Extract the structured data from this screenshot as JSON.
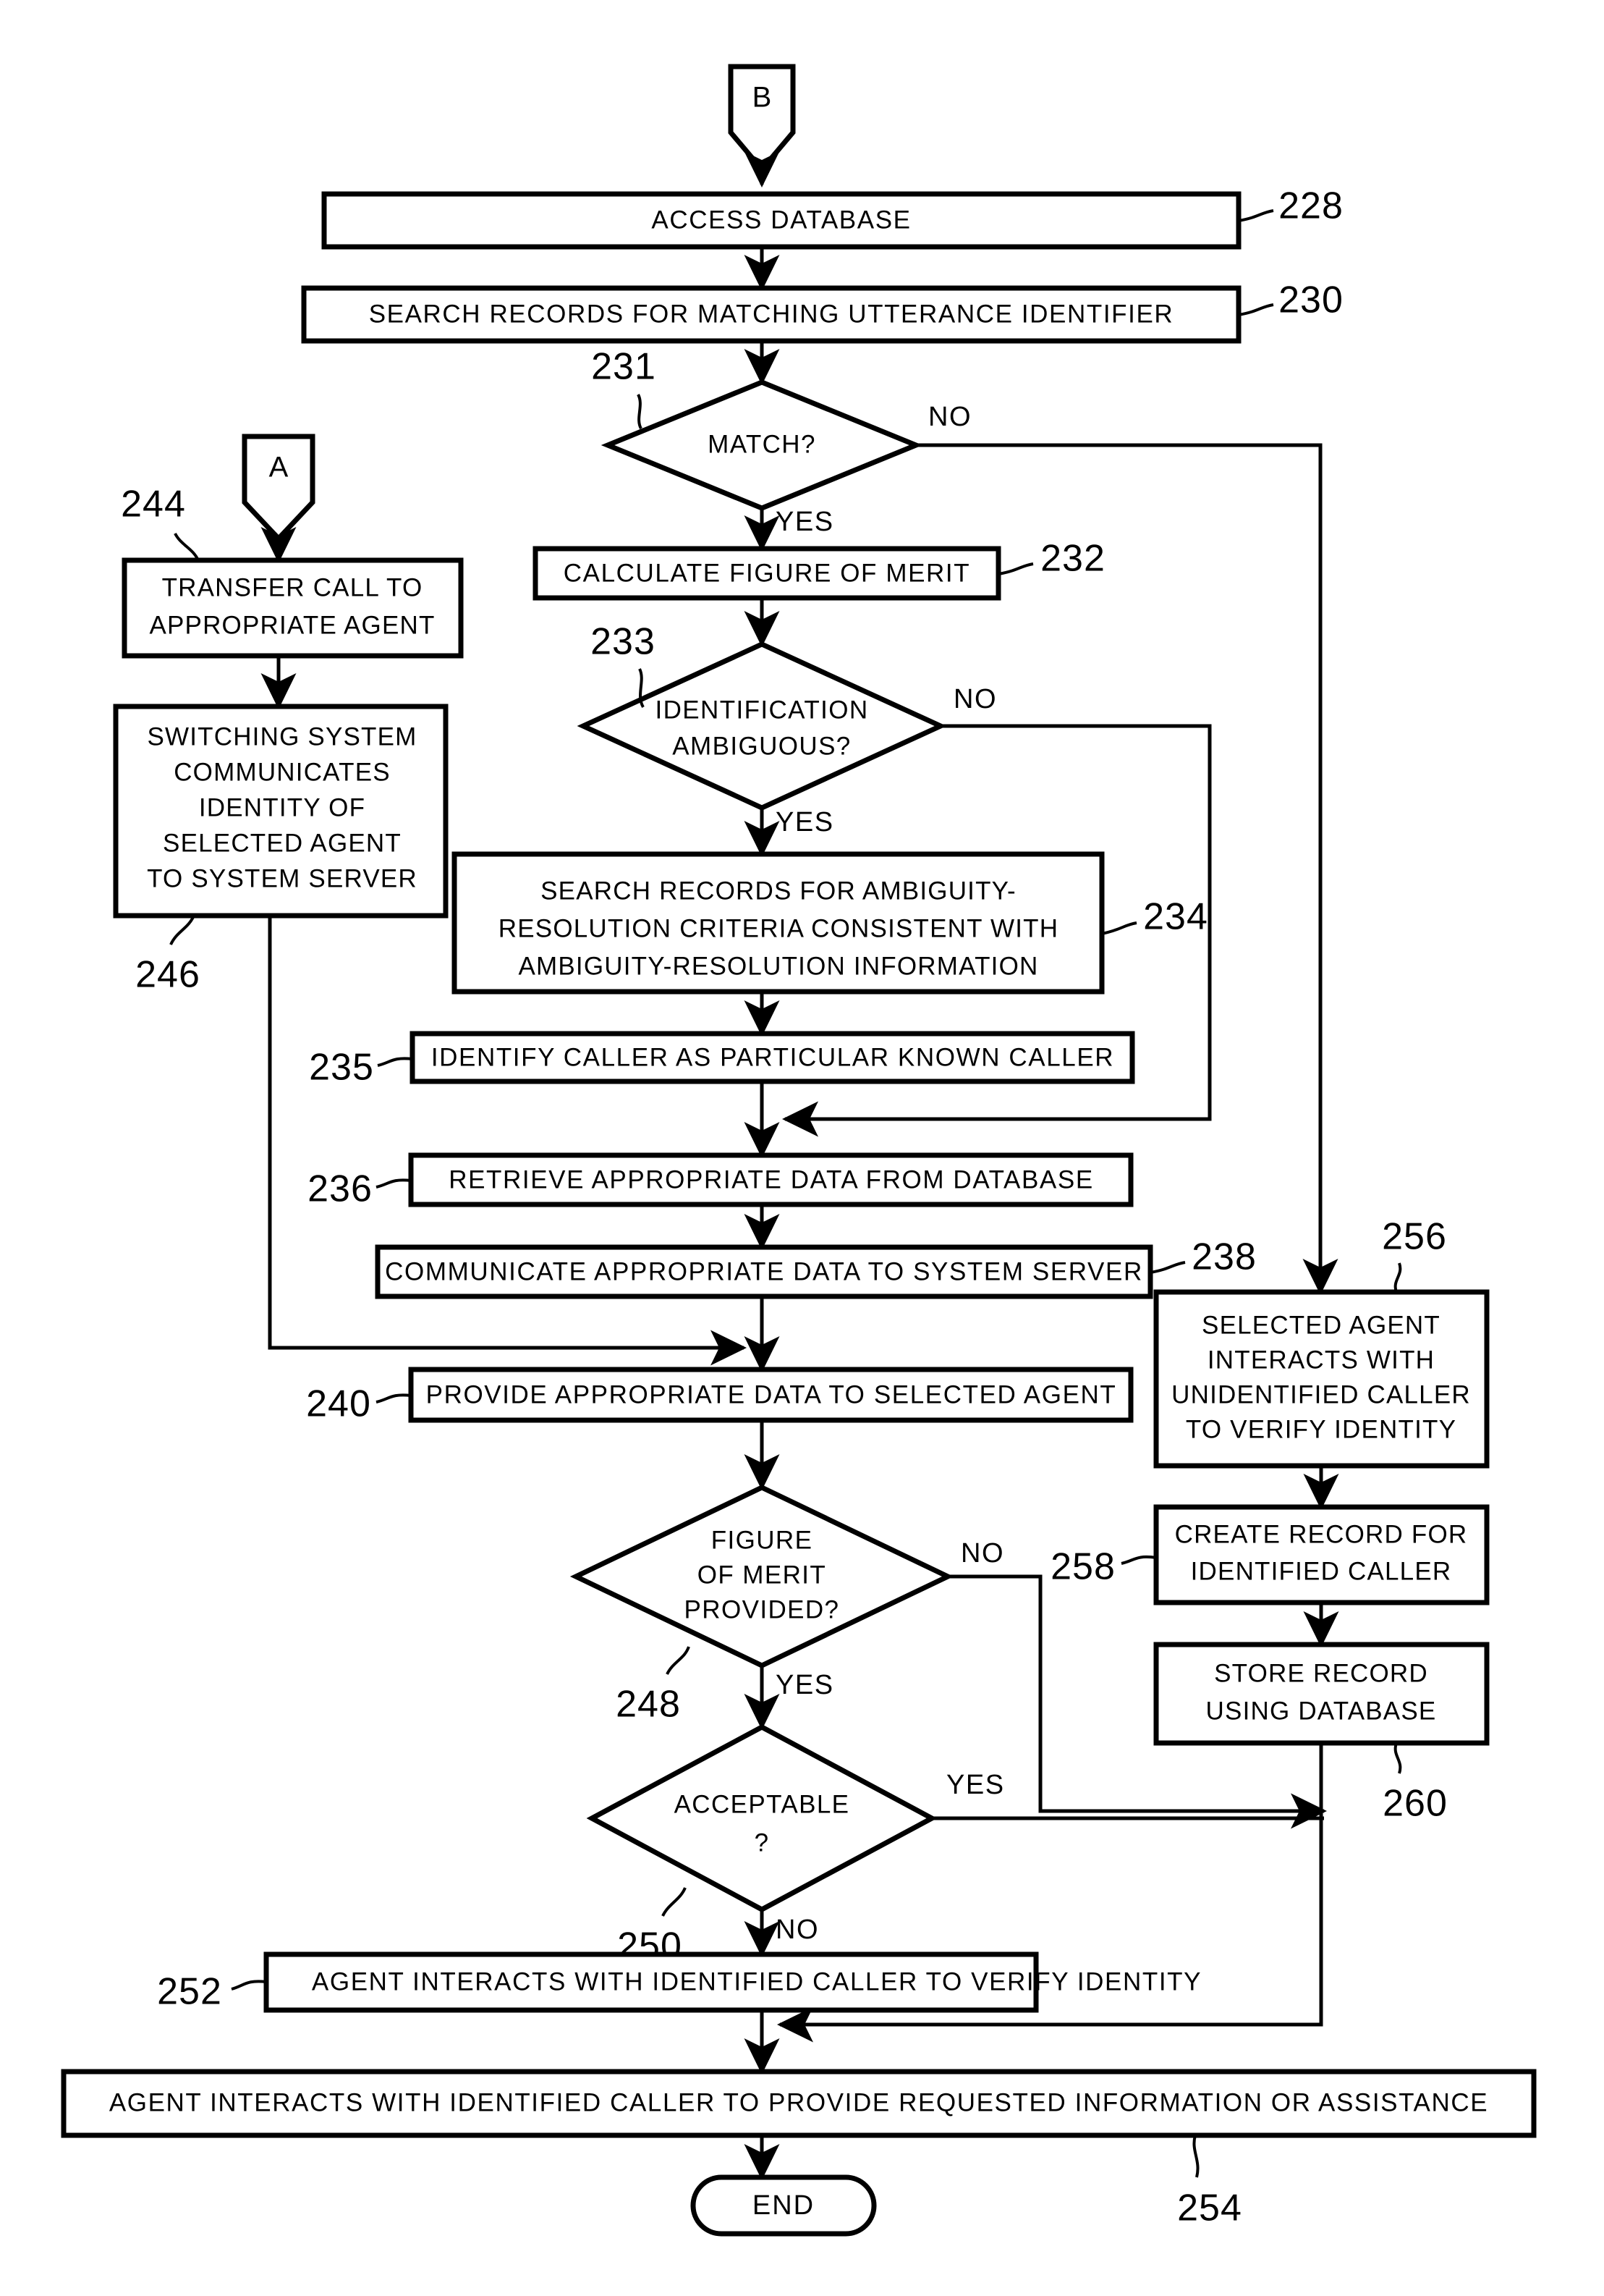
{
  "figure": {
    "type": "patent-flowchart",
    "connectors": [
      {
        "id": "conn-b",
        "label": "B"
      },
      {
        "id": "conn-a",
        "label": "A"
      }
    ],
    "terminator": {
      "label": "END",
      "ref": "254"
    },
    "edge_labels": {
      "yes": "YES",
      "no": "NO"
    },
    "nodes": [
      {
        "id": "n228",
        "ref": "228",
        "shape": "process",
        "lines": [
          "ACCESS DATABASE"
        ]
      },
      {
        "id": "n230",
        "ref": "230",
        "shape": "process",
        "lines": [
          "SEARCH RECORDS FOR MATCHING UTTERANCE IDENTIFIER"
        ]
      },
      {
        "id": "n231",
        "ref": "231",
        "shape": "decision",
        "lines": [
          "MATCH?"
        ]
      },
      {
        "id": "n232",
        "ref": "232",
        "shape": "process",
        "lines": [
          "CALCULATE FIGURE OF MERIT"
        ]
      },
      {
        "id": "n233",
        "ref": "233",
        "shape": "decision",
        "lines": [
          "IDENTIFICATION",
          "AMBIGUOUS?"
        ]
      },
      {
        "id": "n234",
        "ref": "234",
        "shape": "process",
        "lines": [
          "SEARCH RECORDS FOR AMBIGUITY-",
          "RESOLUTION CRITERIA CONSISTENT WITH",
          "AMBIGUITY-RESOLUTION INFORMATION"
        ]
      },
      {
        "id": "n235",
        "ref": "235",
        "shape": "process",
        "lines": [
          "IDENTIFY CALLER AS PARTICULAR KNOWN CALLER"
        ]
      },
      {
        "id": "n236",
        "ref": "236",
        "shape": "process",
        "lines": [
          "RETRIEVE APPROPRIATE DATA FROM DATABASE"
        ]
      },
      {
        "id": "n238",
        "ref": "238",
        "shape": "process",
        "lines": [
          "COMMUNICATE APPROPRIATE DATA TO SYSTEM SERVER"
        ]
      },
      {
        "id": "n240",
        "ref": "240",
        "shape": "process",
        "lines": [
          "PROVIDE APPROPRIATE DATA TO SELECTED AGENT"
        ]
      },
      {
        "id": "n244",
        "ref": "244",
        "shape": "process",
        "lines": [
          "TRANSFER CALL TO",
          "APPROPRIATE AGENT"
        ]
      },
      {
        "id": "n246",
        "ref": "246",
        "shape": "process",
        "lines": [
          "SWITCHING SYSTEM",
          "COMMUNICATES",
          "IDENTITY OF",
          "SELECTED AGENT",
          "TO SYSTEM SERVER"
        ]
      },
      {
        "id": "n248",
        "ref": "248",
        "shape": "decision",
        "lines": [
          "FIGURE",
          "OF MERIT",
          "PROVIDED?"
        ]
      },
      {
        "id": "n250",
        "ref": "250",
        "shape": "decision",
        "lines": [
          "ACCEPTABLE",
          "?"
        ]
      },
      {
        "id": "n252",
        "ref": "252",
        "shape": "process",
        "lines": [
          "AGENT INTERACTS WITH IDENTIFIED CALLER TO VERIFY IDENTITY"
        ]
      },
      {
        "id": "n254",
        "ref": "254",
        "shape": "process",
        "lines": [
          "AGENT INTERACTS WITH IDENTIFIED CALLER TO PROVIDE REQUESTED INFORMATION OR ASSISTANCE"
        ]
      },
      {
        "id": "n256",
        "ref": "256",
        "shape": "process",
        "lines": [
          "SELECTED AGENT",
          "INTERACTS WITH",
          "UNIDENTIFIED CALLER",
          "TO VERIFY IDENTITY"
        ]
      },
      {
        "id": "n258",
        "ref": "258",
        "shape": "process",
        "lines": [
          "CREATE RECORD FOR",
          "IDENTIFIED CALLER"
        ]
      },
      {
        "id": "n260",
        "ref": "260",
        "shape": "process",
        "lines": [
          "STORE RECORD",
          "USING DATABASE"
        ]
      }
    ]
  }
}
